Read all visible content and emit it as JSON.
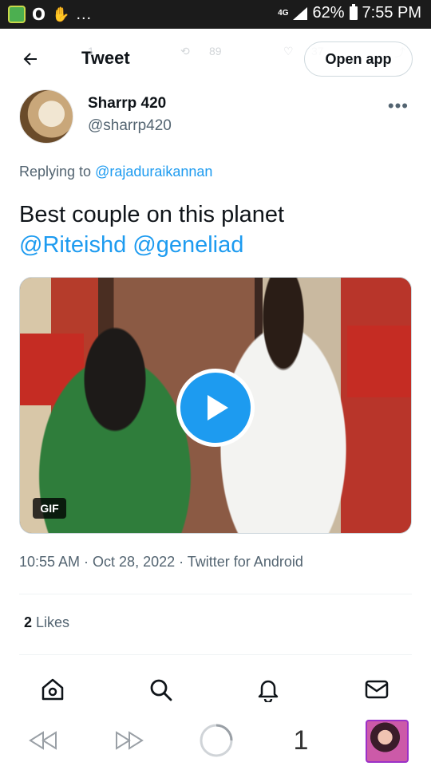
{
  "status_bar": {
    "left_o": "O",
    "overflow": "...",
    "network": "4G",
    "battery_percent": "62%",
    "time": "7:55 PM"
  },
  "header": {
    "title": "Tweet",
    "open_app_label": "Open app",
    "ghost_retweets": "89",
    "ghost_likes": "37",
    "ghost_replies": "1"
  },
  "tweet": {
    "display_name": "Sharrp 420",
    "handle": "@sharrp420",
    "replying_prefix": "Replying to ",
    "replying_to": "@rajaduraikannan",
    "text_main": "Best couple on this planet",
    "mention_1": "@Riteishd",
    "mention_2": "@geneliad",
    "media_badge": "GIF",
    "timestamp": "10:55 AM · Oct 28, 2022 · Twitter for Android",
    "likes_count": "2",
    "likes_label": " Likes"
  },
  "bottom_nav": {
    "items": [
      "home-icon",
      "search-icon",
      "notifications-icon",
      "messages-icon"
    ]
  },
  "browser_bar": {
    "tab_count": "1"
  },
  "colors": {
    "accent": "#1d9bf0",
    "text_primary": "#0f1419",
    "text_secondary": "#536471",
    "status_bar_bg": "#1b1b1b"
  }
}
